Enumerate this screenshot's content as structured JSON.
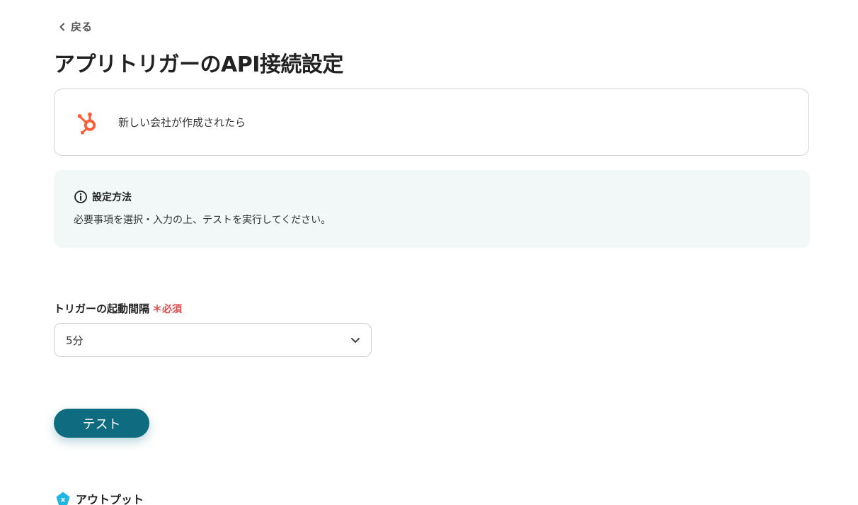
{
  "nav": {
    "back_label": "戻る"
  },
  "header": {
    "title": "アプリトリガーのAPI接続設定"
  },
  "trigger": {
    "app_icon": "hubspot-icon",
    "label": "新しい会社が作成されたら",
    "brand_color": "#ff5c35"
  },
  "info": {
    "icon": "info-icon",
    "title": "設定方法",
    "description": "必要事項を選択・入力の上、テストを実行してください。",
    "background_color": "#f1f8f7"
  },
  "interval_field": {
    "label": "トリガーの起動間隔",
    "required_label": "＊必須",
    "selected_value": "5分",
    "chevron_icon": "chevron-down-icon"
  },
  "test_button": {
    "label": "テスト",
    "color": "#0f6b80"
  },
  "output": {
    "icon": "output-icon",
    "label": "アウトプット",
    "icon_color": "#1fb6e3"
  }
}
